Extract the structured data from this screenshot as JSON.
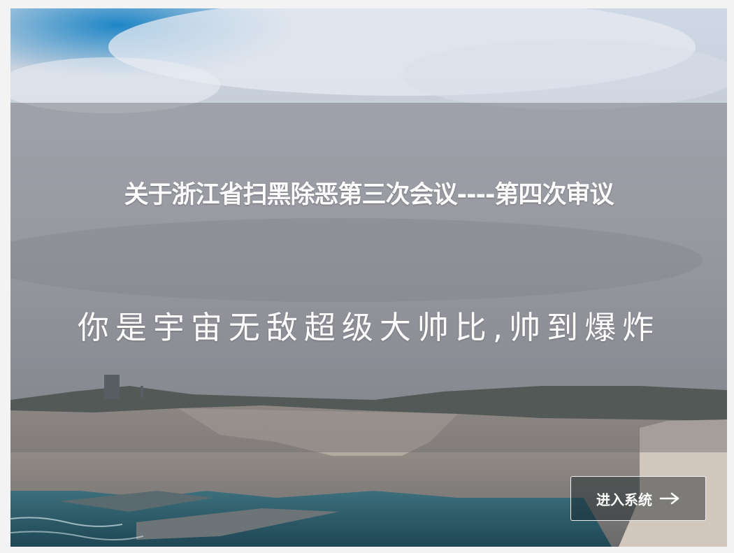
{
  "banner": {
    "title": "关于浙江省扫黑除恶第三次会议----第四次审议",
    "slogan": "你是宇宙无敌超级大帅比,帅到爆炸",
    "enter_button_label": "进入系统",
    "enter_button_icon": "arrow-right-icon"
  },
  "colors": {
    "sky_blue": "#2f8fc7",
    "overlay": "#6e6c70",
    "text": "#ffffff"
  }
}
